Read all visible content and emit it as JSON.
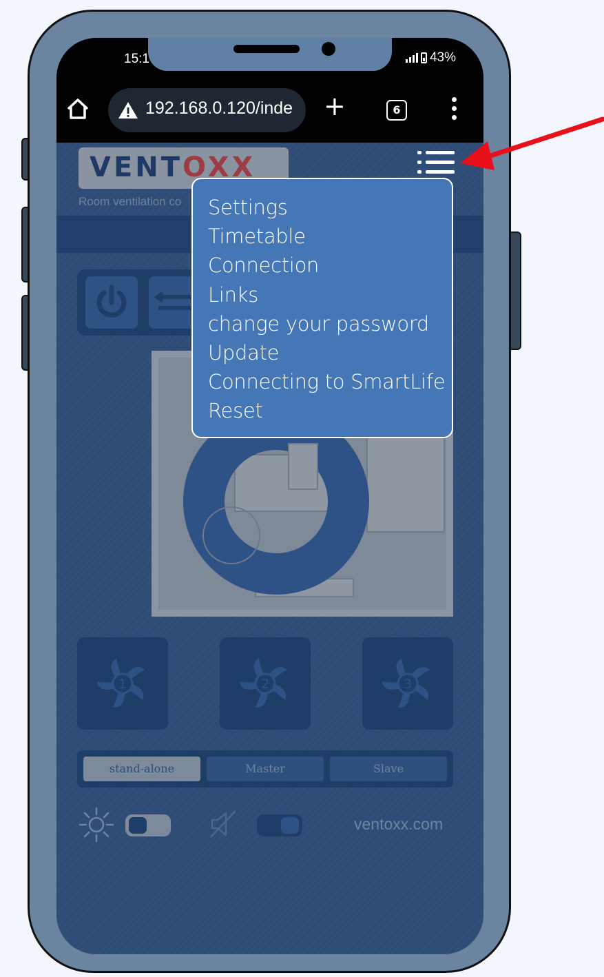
{
  "status_bar": {
    "time": "15:1",
    "battery": "43%"
  },
  "browser": {
    "url": "192.168.0.120/inde",
    "tab_count": "6"
  },
  "page": {
    "logo": {
      "part1": "VENT",
      "part2": "XX"
    },
    "subtitle": "Room ventilation co",
    "fans": [
      {
        "number": "1"
      },
      {
        "number": "2"
      },
      {
        "number": "3"
      }
    ],
    "mode_segments": [
      {
        "label": "stand-alone",
        "active": true
      },
      {
        "label": "Master",
        "active": false
      },
      {
        "label": "Slave",
        "active": false
      }
    ],
    "brightness_toggle": {
      "icon": "sun-icon",
      "on": false
    },
    "sound_toggle": {
      "icon": "mute-icon",
      "on": true
    },
    "website": "ventoxx.com"
  },
  "menu": {
    "items": [
      "Settings",
      "Timetable",
      "Connection",
      "Links",
      "change your password",
      "Update",
      "Connecting to SmartLife",
      "Reset"
    ]
  },
  "colors": {
    "background": "#f3f6fd",
    "phone_frame": "#6b84a0",
    "menu_background": "#4576b6",
    "page_background": "#2e4c75",
    "arrow": "#e8101a"
  }
}
